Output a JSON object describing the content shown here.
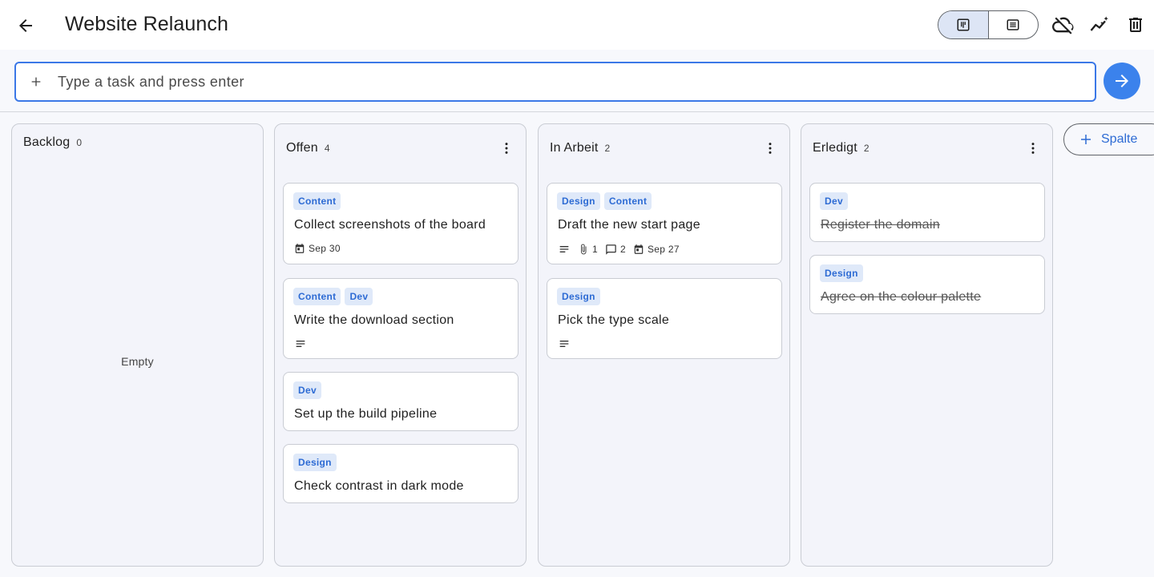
{
  "header": {
    "title": "Website Relaunch"
  },
  "input": {
    "placeholder": "Type a task and press enter"
  },
  "colors": {
    "accent": "#3b82ec",
    "tag_bg": "#dfe9f9",
    "tag_text": "#2d6bd4"
  },
  "icons": {
    "back": "arrow-left-icon",
    "board_view": "board-view-icon",
    "list_view": "list-view-icon",
    "sync": "cloud-off-icon",
    "insights": "insights-icon",
    "delete": "trash-icon",
    "add": "plus-icon",
    "submit": "arrow-right-icon"
  },
  "columns": [
    {
      "title": "Backlog",
      "count": "0",
      "empty_text": "Empty"
    },
    {
      "title": "Offen",
      "count": "4",
      "cards": [
        {
          "tags": [
            "Content"
          ],
          "title": "Collect screenshots of the board",
          "due": "Sep 30"
        },
        {
          "tags": [
            "Content",
            "Dev"
          ],
          "title": "Write the download section"
        },
        {
          "tags": [
            "Dev"
          ],
          "title": "Set up the build pipeline"
        },
        {
          "tags": [
            "Design"
          ],
          "title": "Check contrast in dark mode"
        }
      ]
    },
    {
      "title": "In Arbeit",
      "count": "2",
      "cards": [
        {
          "tags": [
            "Design",
            "Content"
          ],
          "title": "Draft the new start page",
          "attachments": "1",
          "comments": "2",
          "due": "Sep 27"
        },
        {
          "tags": [
            "Design"
          ],
          "title": "Pick the type scale"
        }
      ]
    },
    {
      "title": "Erledigt",
      "count": "2",
      "cards": [
        {
          "tags": [
            "Dev"
          ],
          "title": "Register the domain"
        },
        {
          "tags": [
            "Design"
          ],
          "title": "Agree on the colour palette"
        }
      ]
    }
  ],
  "add_column": {
    "label": "Spalte"
  }
}
